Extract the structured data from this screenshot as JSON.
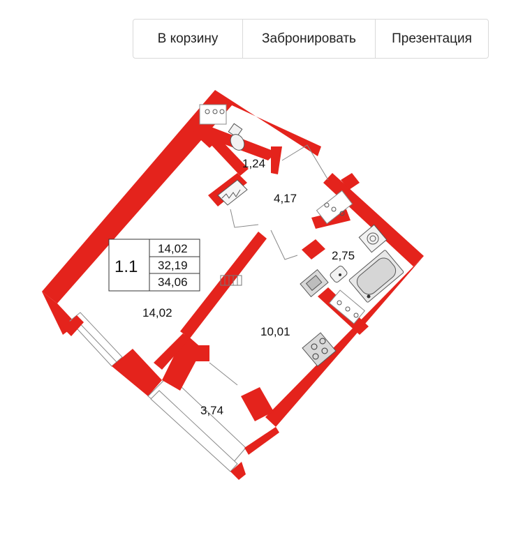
{
  "toolbar": {
    "cart_label": "В корзину",
    "book_label": "Забронировать",
    "presentation_label": "Презентация"
  },
  "plan": {
    "apartment_code": "1.1",
    "living_area": "14,02",
    "total_area": "32,19",
    "total_area_with_balcony": "34,06",
    "rooms": {
      "room": "14,02",
      "bathroom_small": "1,24",
      "hall": "4,17",
      "bathroom": "2,75",
      "kitchen": "10,01",
      "balcony": "3,74"
    },
    "colors": {
      "wall": "#e4231c",
      "fixture": "#555555"
    }
  }
}
